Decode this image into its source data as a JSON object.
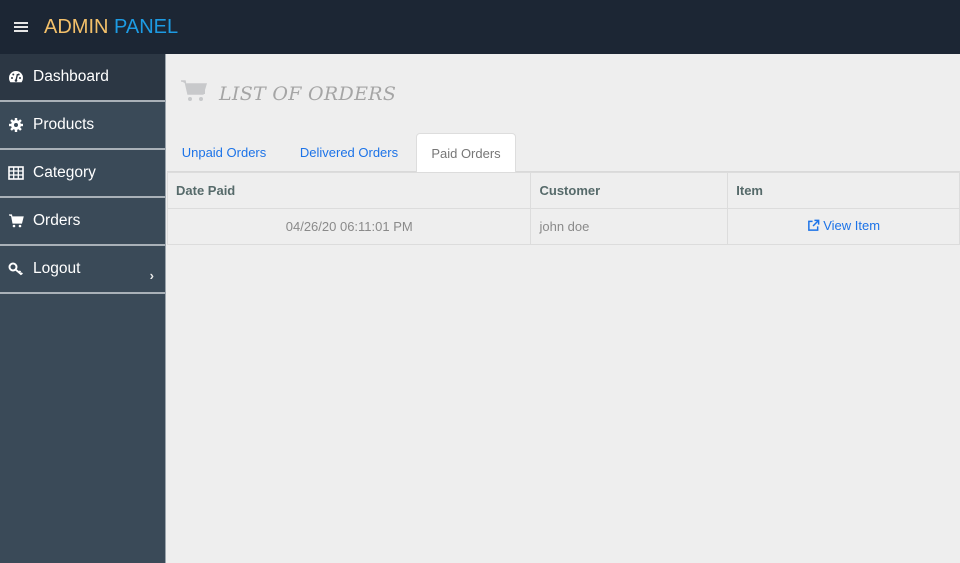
{
  "header": {
    "menu_icon": "hamburger-icon",
    "brand_part1": "ADMIN",
    "brand_part2": "PANEL",
    "brand_color1": "#f3c06a",
    "brand_color2": "#1d9be3"
  },
  "sidebar": {
    "items": [
      {
        "label": "Dashboard",
        "icon": "dashboard-icon",
        "active": true
      },
      {
        "label": "Products",
        "icon": "gear-icon"
      },
      {
        "label": "Category",
        "icon": "table-icon"
      },
      {
        "label": "Orders",
        "icon": "cart-icon"
      },
      {
        "label": "Logout",
        "icon": "key-icon",
        "chevron": "›"
      }
    ]
  },
  "main": {
    "title": "LIST OF ORDERS",
    "title_icon": "cart-icon",
    "tabs": [
      {
        "label": "Unpaid Orders"
      },
      {
        "label": "Delivered Orders"
      },
      {
        "label": "Paid Orders",
        "active": true
      }
    ],
    "table": {
      "headers": [
        "Date Paid",
        "Customer",
        "Item"
      ],
      "rows": [
        {
          "date_paid": "04/26/20 06:11:01 PM",
          "customer": "john doe",
          "item_link": "View Item",
          "item_icon": "external-link-icon"
        }
      ]
    }
  }
}
